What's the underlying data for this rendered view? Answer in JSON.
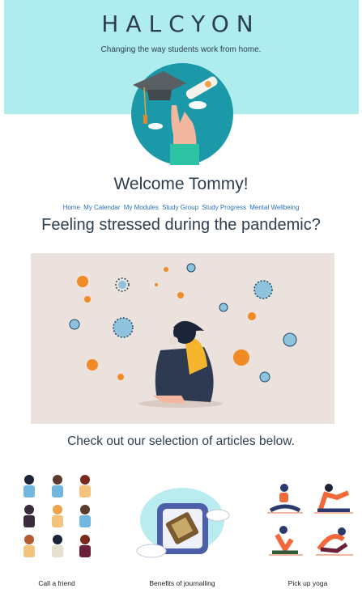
{
  "header": {
    "brand": "HALCYON",
    "tagline": "Changing the way students work from home."
  },
  "welcome": "Welcome Tommy!",
  "nav": {
    "items": [
      "Home",
      "My Calendar",
      "My Modules",
      "Study Group",
      "Study Progress",
      "Mental Wellbeing"
    ]
  },
  "headline": "Feeling stressed during the pandemic?",
  "subheading": "Check out our selection of articles below.",
  "articles": [
    {
      "caption": "Call a friend"
    },
    {
      "caption": "Benefits of journalling"
    },
    {
      "caption": "Pick up yoga"
    }
  ],
  "colors": {
    "banner": "#afeced",
    "link": "#2f6fb5",
    "text": "#2c3e50",
    "illustration_bg": "#ebe2de"
  },
  "icons": [
    "graduation-cap-icon",
    "diploma-icon",
    "virus-icon",
    "phone-call-icon",
    "journal-icon",
    "yoga-icon"
  ]
}
